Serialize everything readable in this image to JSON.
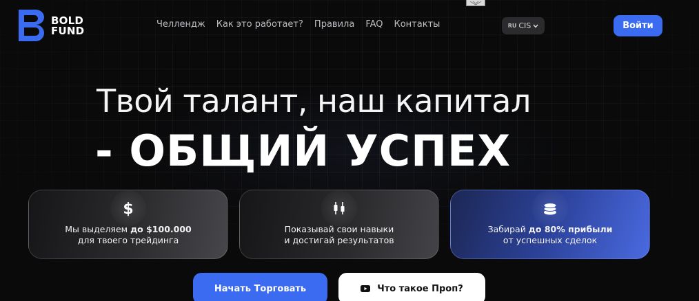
{
  "brand": {
    "line1": "BOLD",
    "line2": "FUND"
  },
  "nav": [
    "Челлендж",
    "Как это работает?",
    "Правила",
    "FAQ",
    "Контакты"
  ],
  "region": {
    "lang": "RU",
    "label": "CIS"
  },
  "login_label": "Войти",
  "hero": {
    "line1": "Твой талант, наш капитал",
    "line2": "- ОБЩИЙ УСПЕХ"
  },
  "cards": [
    {
      "icon": "dollar-icon",
      "text_before": "Мы выделяем ",
      "text_bold": "до $100.000",
      "text_line2": "для твоего трейдинга"
    },
    {
      "icon": "candlestick-icon",
      "text_before": "Показывай свои навыки",
      "text_bold": "",
      "text_line2": "и достигай результатов"
    },
    {
      "icon": "coins-icon",
      "text_before": "Забирай ",
      "text_bold": "до 80% прибыли",
      "text_line2": "от успешных сделок"
    }
  ],
  "buttons": {
    "start": "Начать Торговать",
    "prop": "Что такое Проп?"
  },
  "colors": {
    "accent": "#3b6bf0",
    "background": "#0a0a0b"
  }
}
